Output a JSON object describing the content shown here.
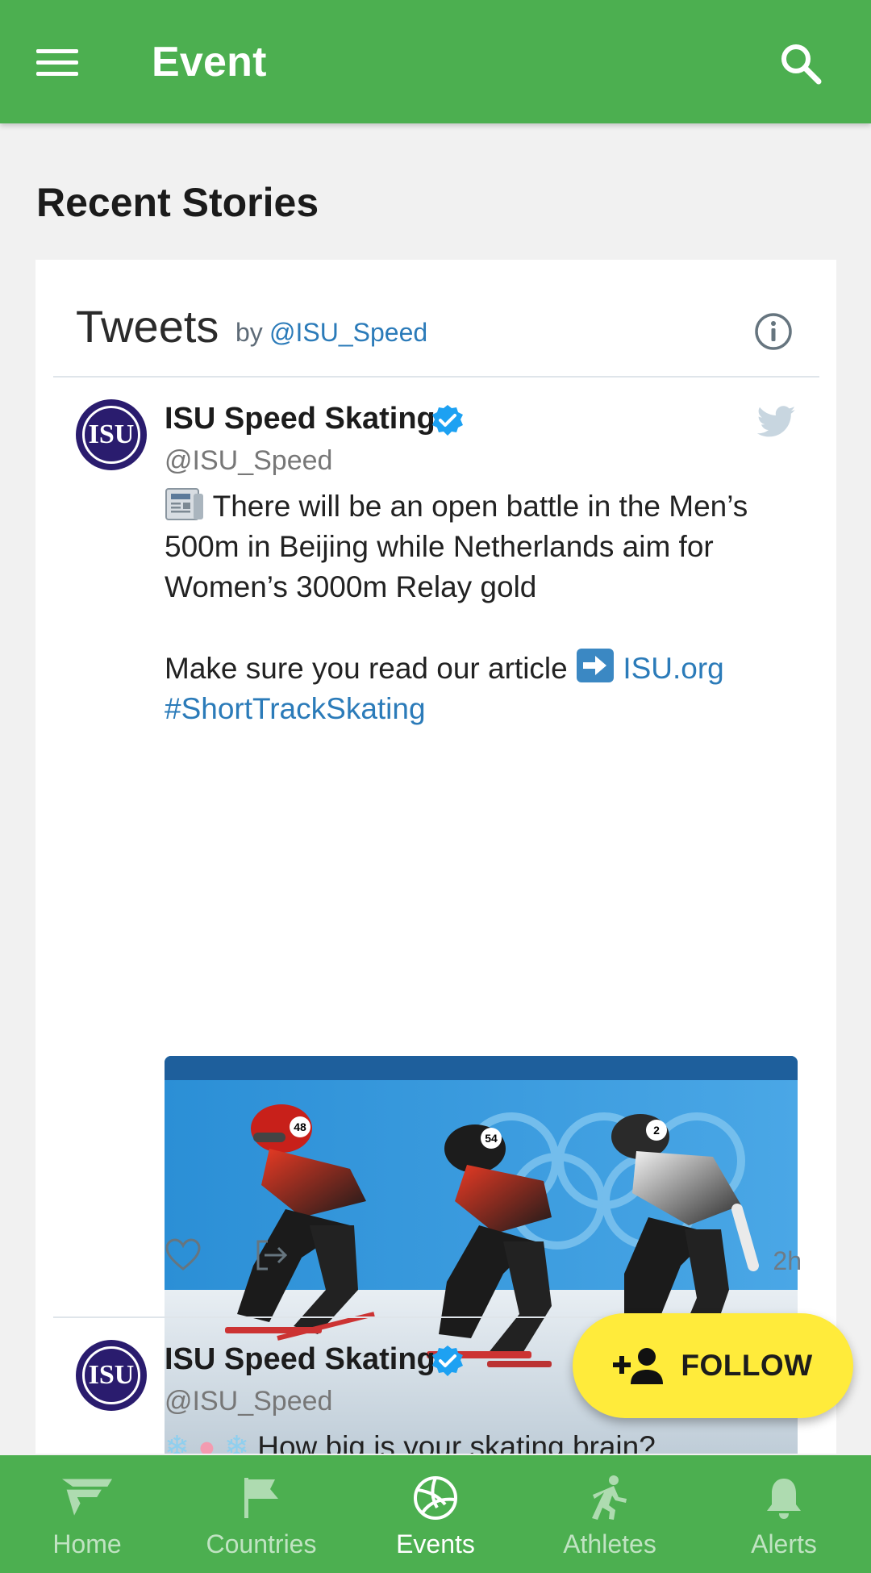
{
  "appbar": {
    "title": "Event"
  },
  "section_title": "Recent Stories",
  "widget": {
    "title": "Tweets",
    "by": "by",
    "handle": "@ISU_Speed"
  },
  "tweets": [
    {
      "name": "ISU Speed Skating",
      "handle": "@ISU_Speed",
      "text_line1": "There will be an open battle in the Men’s 500m in Beijing while Netherlands aim for Women’s 3000m Relay gold",
      "text_line2": "Make sure you read our article",
      "link": "ISU.org",
      "hashtag": "#ShortTrackSkating",
      "time": "2h",
      "photo_numbers": [
        "48",
        "54",
        "2"
      ]
    },
    {
      "name": "ISU Speed Skating",
      "handle": "@ISU_Speed",
      "text_line1": "How big is your skating brain?"
    }
  ],
  "fab": {
    "label": "FOLLOW"
  },
  "nav": [
    {
      "label": "Home",
      "icon": "home-logo-icon",
      "active": false
    },
    {
      "label": "Countries",
      "icon": "flag-icon",
      "active": false
    },
    {
      "label": "Events",
      "icon": "volleyball-icon",
      "active": true
    },
    {
      "label": "Athletes",
      "icon": "running-icon",
      "active": false
    },
    {
      "label": "Alerts",
      "icon": "bell-icon",
      "active": false
    }
  ],
  "colors": {
    "primary": "#4caf50",
    "accent": "#ffeb3b",
    "link": "#2b7bb9",
    "avatar": "#2a1c6e"
  }
}
